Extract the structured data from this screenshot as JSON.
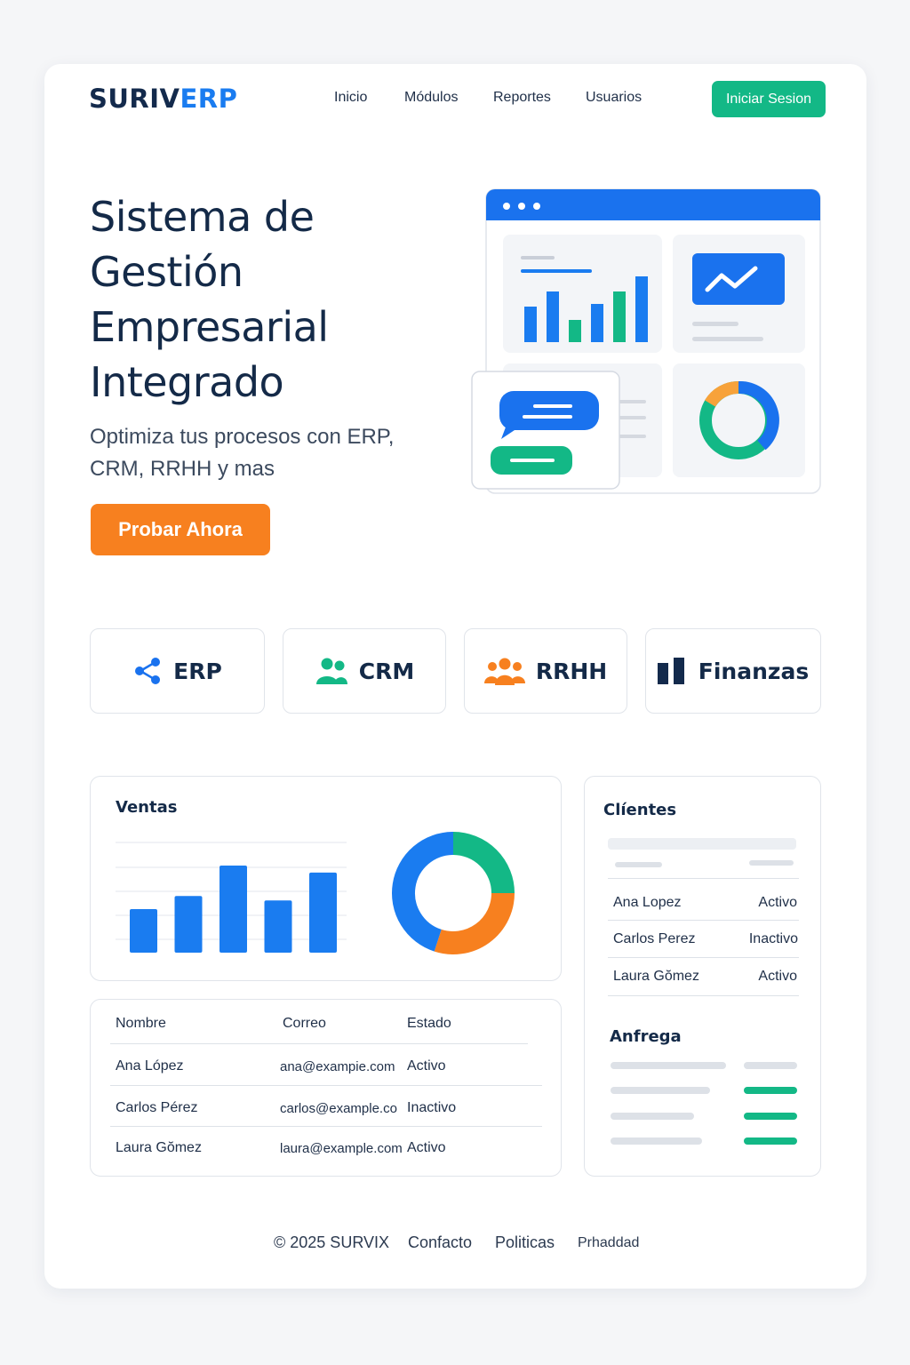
{
  "colors": {
    "navy": "#142a48",
    "brand_blue": "#1a7cf0",
    "green": "#13b886",
    "orange": "#f7801f",
    "light_gray": "#e6e9ee"
  },
  "header": {
    "logo_part1": "SURIV",
    "logo_part2": "ERP",
    "nav": [
      "Inicio",
      "Módulos",
      "Reportes",
      "Usuarios"
    ],
    "login_label": "Iniciar Sesion"
  },
  "hero": {
    "title": "Sistema de Gestión Empresarial Integrado",
    "subtitle": "Optimiza tus procesos con ERP, CRM, RRHH y mas",
    "cta_label": "Probar Ahora"
  },
  "modules": [
    {
      "label": "ERP",
      "icon": "share-nodes-icon"
    },
    {
      "label": "CRM",
      "icon": "users-icon"
    },
    {
      "label": "RRHH",
      "icon": "team-icon"
    },
    {
      "label": "Finanzas",
      "icon": "columns-icon"
    }
  ],
  "sales": {
    "title": "Ventas",
    "chart_data": [
      {
        "type": "bar",
        "values": [
          50,
          65,
          100,
          60,
          92
        ],
        "ylim": [
          0,
          100
        ],
        "grid": true
      },
      {
        "type": "pie",
        "slices": [
          {
            "value": 25,
            "color": "#13b886"
          },
          {
            "value": 30,
            "color": "#f7801f"
          },
          {
            "value": 45,
            "color": "#1a7cf0"
          }
        ]
      }
    ]
  },
  "users_table": {
    "headers": [
      "Nombre",
      "Correo",
      "Estado"
    ],
    "rows": [
      [
        "Ana López",
        "ana@exampie.com",
        "Activo"
      ],
      [
        "Carlos Pérez",
        "carlos@example.cor",
        "Inactivo"
      ],
      [
        "Laura Gŏmez",
        "laura@example.com",
        "Activo"
      ]
    ]
  },
  "clients": {
    "title": "Clíentes",
    "rows": [
      {
        "name": "Ana Lopez",
        "state": "Activo"
      },
      {
        "name": "Carlos Perez",
        "state": "Inactivo"
      },
      {
        "name": "Laura Gŏmez",
        "state": "Activo"
      }
    ]
  },
  "delivery": {
    "title": "Anfrega"
  },
  "footer": {
    "copyright": "© 2025 SURVIX",
    "links": [
      "Confacto",
      "Politicas",
      "Prhaddad"
    ]
  }
}
